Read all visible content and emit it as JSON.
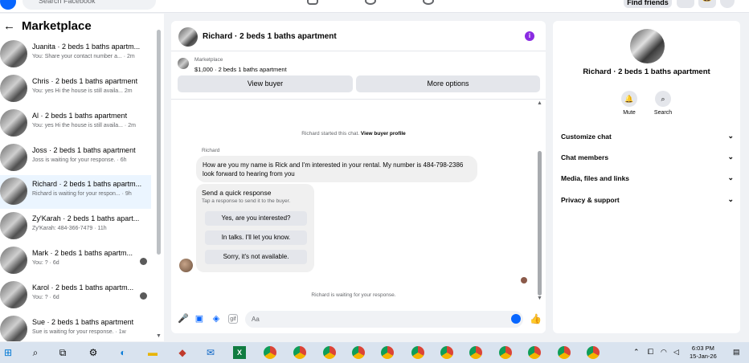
{
  "topbar": {
    "search_placeholder": "Search Facebook",
    "find_friends": "Find friends",
    "menu_glyph": "•••",
    "bell_glyph": "🔔",
    "profile_glyph": "▾"
  },
  "left": {
    "back_arrow": "←",
    "title": "Marketplace",
    "conversations": [
      {
        "name": "Juanita · 2 beds 1 baths apartm...",
        "sub": "You: Share your contact number a... · 2m"
      },
      {
        "name": "Chris · 2 beds 1 baths apartment",
        "sub": "You: yes Hi the house is still availa... 2m"
      },
      {
        "name": "Al · 2 beds 1 baths apartment",
        "sub": "You: yes Hi the house is still availa... · 2m"
      },
      {
        "name": "Joss · 2 beds 1 baths apartment",
        "sub": "Joss is waiting for your response. · 6h"
      },
      {
        "name": "Richard · 2 beds 1 baths apartm...",
        "sub": "Richard is waiting for your respon... · 9h"
      },
      {
        "name": "Zy'Karah · 2 beds 1 baths apart...",
        "sub": "Zy'Karah: 484-366-7479 · 11h"
      },
      {
        "name": "Mark · 2 beds 1 baths apartm...",
        "sub": "You: ? · 6d"
      },
      {
        "name": "Karol · 2 beds 1 baths apartm...",
        "sub": "You: ? · 6d"
      },
      {
        "name": "Sue · 2 beds 1 baths apartment",
        "sub": "Sue is waiting for your response. · 1w"
      }
    ]
  },
  "chat": {
    "title": "Richard · 2 beds 1 baths apartment",
    "info_glyph": "i",
    "marketplace_label": "Marketplace",
    "listing": "$1,000 · 2 beds 1 baths apartment",
    "view_buyer": "View buyer",
    "more_options": "More options",
    "started_note": "Richard started this chat.",
    "view_profile": "View buyer profile",
    "sender": "Richard",
    "message": "How are you my name is Rick and I'm interested in your rental. My number is 484-798-2386 look forward to hearing from you",
    "quick_title": "Send a quick response",
    "quick_sub": "Tap a response to send it to the buyer.",
    "quick_options": [
      "Yes, are you interested?",
      "In talks. I'll let you know.",
      "Sorry, it's not available."
    ],
    "waiting_note": "Richard is waiting for your response.",
    "composer_placeholder": "Aa"
  },
  "right": {
    "name": "Richard · 2 beds 1 baths apartment",
    "mute": "Mute",
    "search": "Search",
    "sections": [
      "Customize chat",
      "Chat members",
      "Media, files and links",
      "Privacy & support"
    ]
  },
  "taskbar": {
    "time": "6:03 PM",
    "date": "15-Jan-26"
  }
}
